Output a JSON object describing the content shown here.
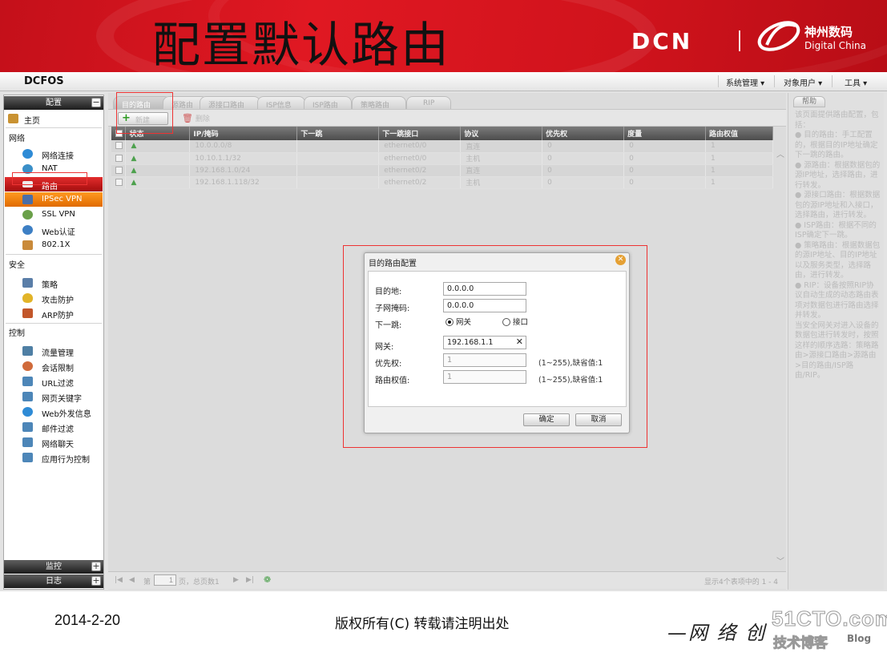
{
  "slide": {
    "title": "配置默认路由",
    "brand_dcn": "DCN",
    "brand_cn": "神州数码",
    "brand_en": "Digital China",
    "date": "2014-2-20",
    "copyright": "版权所有(C) 转载请注明出处",
    "slogan": "—网 络 创",
    "watermark_main": "51CTO.com",
    "watermark_sub": "技术博客",
    "watermark_blog": "Blog"
  },
  "app": {
    "brand": "DCFOS",
    "top_menu": [
      "系统管理",
      "对象用户",
      "工具"
    ]
  },
  "sidebar": {
    "config_header": "配置",
    "home": "主页",
    "sections": [
      {
        "label": "网络",
        "items": [
          "网络连接",
          "NAT",
          "路由",
          "IPSec VPN",
          "SSL VPN",
          "Web认证",
          "802.1X"
        ]
      },
      {
        "label": "安全",
        "items": [
          "策略",
          "攻击防护",
          "ARP防护"
        ]
      },
      {
        "label": "控制",
        "items": [
          "流量管理",
          "会话限制",
          "URL过滤",
          "网页关键字",
          "Web外发信息",
          "邮件过滤",
          "网络聊天",
          "应用行为控制"
        ]
      }
    ],
    "monitor_header": "监控",
    "log_header": "日志"
  },
  "main": {
    "tabs": [
      "目的路由",
      "源路由",
      "源接口路由",
      "ISP信息",
      "ISP路由",
      "策略路由",
      "RIP"
    ],
    "toolbar": {
      "new_label": "新建",
      "delete_label": "删除"
    },
    "table": {
      "headers": [
        "状态",
        "IP/掩码",
        "下一跳",
        "下一跳接口",
        "协议",
        "优先权",
        "度量",
        "路由权值"
      ],
      "rows": [
        [
          "10.0.0.0/8",
          "",
          "ethernet0/0",
          "直连",
          "0",
          "0",
          "1"
        ],
        [
          "10.10.1.1/32",
          "",
          "ethernet0/0",
          "主机",
          "0",
          "0",
          "1"
        ],
        [
          "192.168.1.0/24",
          "",
          "ethernet0/2",
          "直连",
          "0",
          "0",
          "1"
        ],
        [
          "192.168.1.118/32",
          "",
          "ethernet0/2",
          "主机",
          "0",
          "0",
          "1"
        ]
      ]
    },
    "pager": {
      "page_prefix": "第",
      "page_value": "1",
      "page_suffix": "页，总页数1",
      "summary": "显示4个表项中的 1 - 4"
    }
  },
  "help": {
    "tab": "帮助",
    "paragraphs": [
      "该页面提供路由配置，包括：",
      "● 目的路由：手工配置的，根据目的IP地址确定下一跳的路由。",
      "● 源路由：根据数据包的源IP地址，选择路由，进行转发。",
      "● 源接口路由：根据数据包的源IP地址和入接口，选择路由，进行转发。",
      "● ISP路由：根据不同的ISP确定下一跳。",
      "● 策略路由：根据数据包的源IP地址、目的IP地址以及服务类型，选择路由，进行转发。",
      "● RIP：设备按照RIP协议自动生成的动态路由表项对数据包进行路由选择并转发。",
      "当安全网关对进入设备的数据包进行转发时，按照这样的顺序选路：策略路由>源接口路由>源路由>目的路由/ISP路由/RIP。"
    ]
  },
  "dialog": {
    "title": "目的路由配置",
    "dest_label": "目的地:",
    "dest_value": "0.0.0.0",
    "mask_label": "子网掩码:",
    "mask_value": "0.0.0.0",
    "nexthop_label": "下一跳:",
    "opt_gateway": "网关",
    "opt_interface": "接口",
    "gateway_label": "网关:",
    "gateway_value": "192.168.1.1",
    "priority_label": "优先权:",
    "priority_value": "1",
    "priority_hint": "(1~255),缺省值:1",
    "weight_label": "路由权值:",
    "weight_value": "1",
    "weight_hint": "(1~255),缺省值:1",
    "ok": "确定",
    "cancel": "取消"
  },
  "colors": {
    "banner_red": "#d0131c",
    "active_nav": "#c41a1a",
    "highlight_nav": "#f07a10",
    "annotation": "#ee3333"
  }
}
